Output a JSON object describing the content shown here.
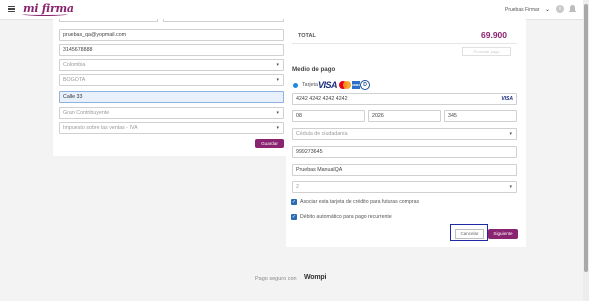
{
  "header": {
    "logo_text": "mi firma",
    "user_name": "Pruebas Firmar",
    "chevron": "⌄",
    "info": "i"
  },
  "left_form": {
    "partial_field_label": "",
    "email": "pruebas_qa@yopmail.com",
    "phone": "3145678888",
    "country": "Colombia",
    "city": "BOGOTA",
    "address": "Calle 33",
    "taxpayer": "Gran Contribuyente",
    "tax": "Impuesto sobre las ventas - IVA",
    "save_label": "Guardar"
  },
  "summary": {
    "total_label": "TOTAL",
    "total_value": "69.900",
    "ghost_button": "Procesar pago"
  },
  "payment": {
    "section_title": "Medio de pago",
    "method_label": "Tarjeta",
    "brand_visa": "VISA",
    "brand_amex": "AMEX",
    "brand_diners": "D",
    "card_number": "4242 4242 4242 4242",
    "card_brand_badge": "VISA",
    "month": "08",
    "year": "2026",
    "cvc": "345",
    "id_type": "Cédula de ciudadanía",
    "id_number": "999273645",
    "holder_name": "Pruebas ManualQA",
    "installments": "2",
    "check1_label": "Asociar esta tarjeta de crédito para futuras compras",
    "check2_label": "Débito automático para pago recurrente",
    "check_mark": "✓",
    "cancel_label": "Cancelar",
    "next_label": "Siguiente"
  },
  "footer": {
    "text": "Pago seguro con",
    "brand": "Wompi"
  },
  "colors": {
    "brand": "#8a2470",
    "highlight": "#1e2aa8",
    "checkbox": "#2a6bb5"
  },
  "icons": [
    "menu-icon",
    "chevron-down-icon",
    "info-icon",
    "bell-icon",
    "caret-down-icon",
    "checkbox-checked-icon"
  ]
}
